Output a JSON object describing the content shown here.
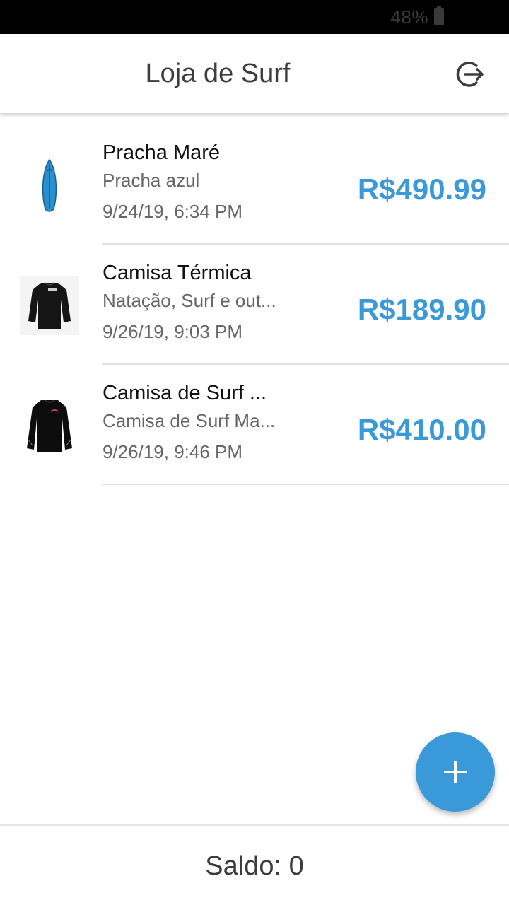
{
  "status_bar": {
    "battery": "48%",
    "battery_icon": "battery-icon"
  },
  "app_bar": {
    "title": "Loja de Surf",
    "action_icon": "logout-icon"
  },
  "products": [
    {
      "title": "Pracha Maré",
      "subtitle": "Pracha azul",
      "date": "9/24/19, 6:34 PM",
      "price": "R$490.99",
      "image": "surfboard-image"
    },
    {
      "title": "Camisa Térmica",
      "subtitle": "Natação, Surf e out...",
      "date": "9/26/19, 9:03 PM",
      "price": "R$189.90",
      "image": "thermal-shirt-image"
    },
    {
      "title": "Camisa de Surf ...",
      "subtitle": "Camisa de Surf Ma...",
      "date": "9/26/19, 9:46 PM",
      "price": "R$410.00",
      "image": "surf-shirt-image"
    }
  ],
  "fab": {
    "icon": "plus-icon"
  },
  "footer": {
    "saldo": "Saldo: 0"
  },
  "colors": {
    "accent": "#3a9ad9",
    "divider": "#e0e0e0",
    "status_bar": "#000000"
  }
}
